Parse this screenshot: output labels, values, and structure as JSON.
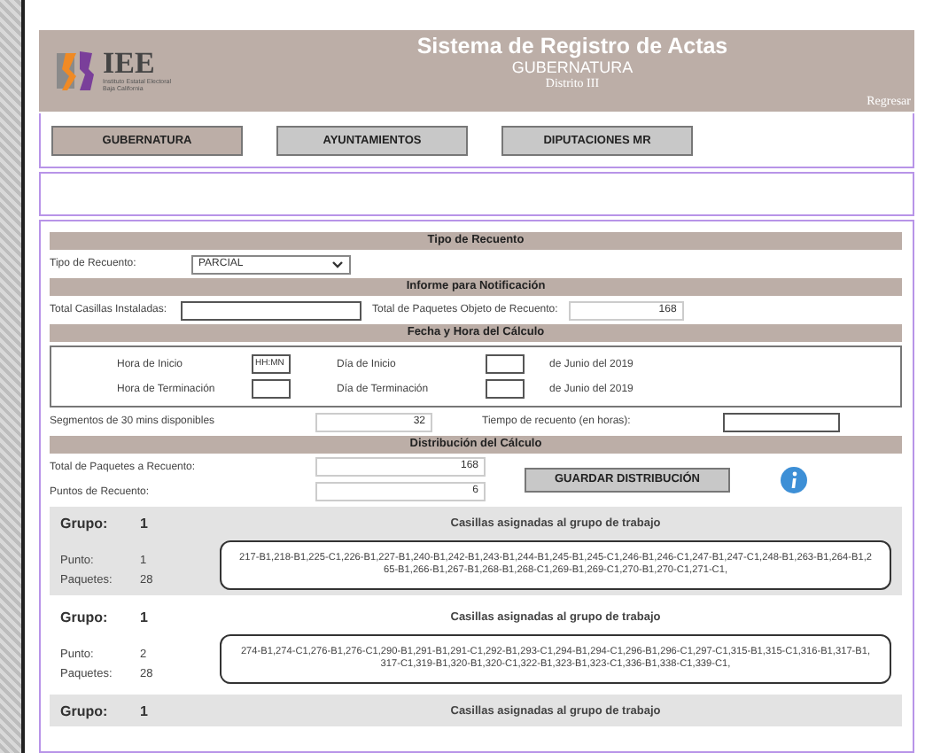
{
  "header": {
    "logo_text": "IEE",
    "logo_caption": [
      "Instituto Estatal Electoral",
      "Baja California"
    ],
    "title": "Sistema de Registro de Actas",
    "subtitle": "GUBERNATURA",
    "district": "Distrito III",
    "back_link": "Regresar"
  },
  "nav_tabs": [
    {
      "label": "GUBERNATURA",
      "selected": true
    },
    {
      "label": "AYUNTAMIENTOS",
      "selected": false
    },
    {
      "label": "DIPUTACIONES MR",
      "selected": false
    }
  ],
  "tipo_recuento": {
    "heading": "Tipo de Recuento",
    "label": "Tipo de Recuento:",
    "value": "PARCIAL"
  },
  "informe": {
    "heading": "Informe para Notificación",
    "fields": [
      {
        "label": "Total Casillas Instaladas:"
      },
      {
        "label": "Total de Paquetes Objeto de Recuento:",
        "value": "168"
      }
    ]
  },
  "fecha": {
    "heading": "Fecha y Hora del Cálculo",
    "rows": [
      {
        "hora_label": "Hora de Inicio",
        "hora_placeholder": "HH:MN",
        "dia_label": "Día de Inicio",
        "suffix": "de Junio del 2019"
      },
      {
        "hora_label": "Hora de Terminación",
        "dia_label": "Día de Terminación",
        "suffix": "de Junio del 2019"
      }
    ],
    "segmentos_label": "Segmentos de 30 mins disponibles",
    "segmentos_value": "32",
    "tiempo_label": "Tiempo de recuento (en horas):"
  },
  "distribucion": {
    "heading": "Distribución del Cálculo",
    "total_label": "Total de Paquetes a Recuento:",
    "total_value": "168",
    "puntos_label": "Puntos de Recuento:",
    "puntos_value": "6",
    "save_button": "GUARDAR DISTRIBUCIÓN"
  },
  "groups": [
    {
      "grupo_label": "Grupo:",
      "grupo": "1",
      "casillas_title": "Casillas asignadas al grupo de trabajo",
      "casillas": "217-B1,218-B1,225-C1,226-B1,227-B1,240-B1,242-B1,243-B1,244-B1,245-B1,245-C1,246-B1,246-C1,247-B1,247-C1,248-B1,263-B1,264-B1,265-B1,266-B1,267-B1,268-B1,268-C1,269-B1,269-C1,270-B1,270-C1,271-C1,",
      "punto_label": "Punto:",
      "punto": "1",
      "paquetes_label": "Paquetes:",
      "paquetes": "28"
    },
    {
      "grupo_label": "Grupo:",
      "grupo": "1",
      "casillas_title": "Casillas asignadas al grupo de trabajo",
      "casillas": "274-B1,274-C1,276-B1,276-C1,290-B1,291-B1,291-C1,292-B1,293-C1,294-B1,294-C1,296-B1,296-C1,297-C1,315-B1,315-C1,316-B1,317-B1,317-C1,319-B1,320-B1,320-C1,322-B1,323-B1,323-C1,336-B1,338-C1,339-C1,",
      "punto_label": "Punto:",
      "punto": "2",
      "paquetes_label": "Paquetes:",
      "paquetes": "28"
    },
    {
      "grupo_label": "Grupo:",
      "grupo": "1",
      "casillas_title": "Casillas asignadas al grupo de trabajo"
    }
  ]
}
